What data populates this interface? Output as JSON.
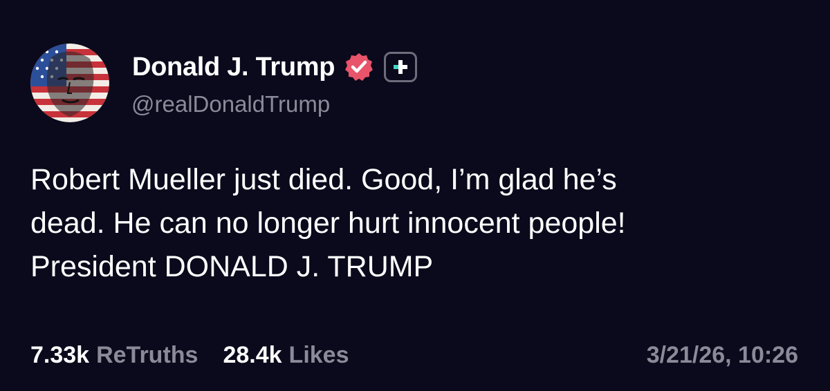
{
  "author": {
    "display_name": "Donald J. Trump",
    "handle": "@realDonaldTrump",
    "verified_icon": "verified-badge-icon",
    "plus_icon": "plus-badge-icon",
    "avatar_icon": "flag-portrait-avatar"
  },
  "post": {
    "lines": [
      "Robert Mueller just died. Good, I’m glad he’s",
      "dead. He can no longer hurt innocent people!",
      "President DONALD J. TRUMP"
    ]
  },
  "stats": {
    "retruths_count": "7.33k",
    "retruths_label": "ReTruths",
    "likes_count": "28.4k",
    "likes_label": "Likes"
  },
  "timestamp": "3/21/26, 10:26",
  "colors": {
    "background": "#0b0a1c",
    "verified": "#e8546a",
    "muted_text": "#8a8a99",
    "plus_accent": "#3fd9c5"
  }
}
